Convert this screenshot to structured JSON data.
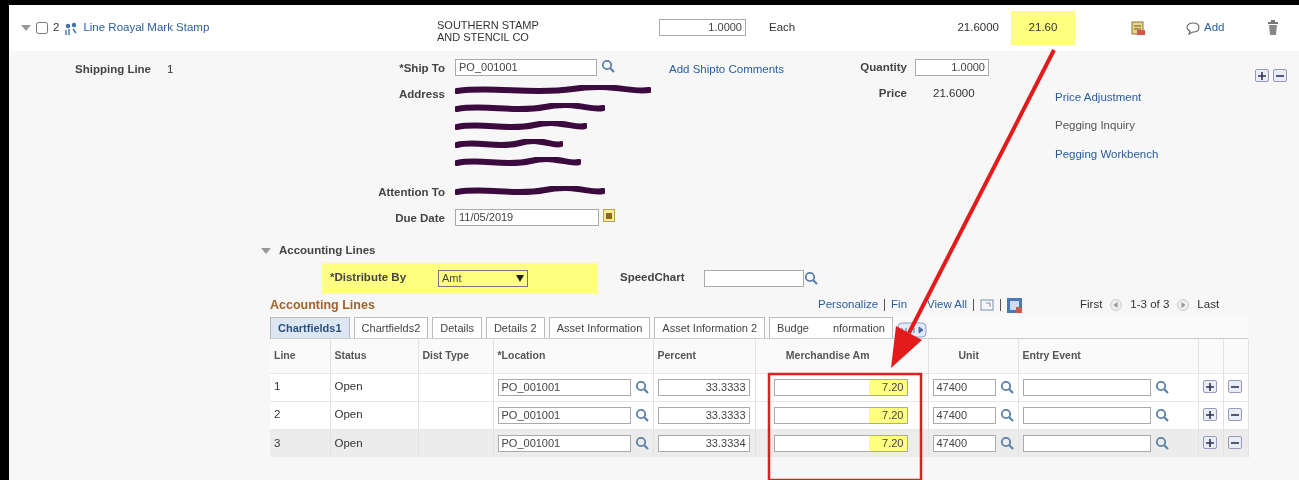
{
  "item_line": {
    "expanded": true,
    "checked": false,
    "number": "2",
    "description": "Line Roayal Mark Stamp",
    "vendor": [
      "SOUTHERN STAMP",
      "AND STENCIL CO"
    ],
    "quantity": "1.0000",
    "uom": "Each",
    "price": "21.6000",
    "amount": "21.60",
    "amount_highlighted": true,
    "comment_label": "Add"
  },
  "shipping": {
    "label": "Shipping Line",
    "number": "1",
    "ship_to_label": "*Ship To",
    "ship_to": "PO_001001",
    "address_label": "Address",
    "attention_label": "Attention To",
    "due_date_label": "Due Date",
    "due_date": "11/05/2019",
    "comments_link": "Add Shipto Comments",
    "quantity_label": "Quantity",
    "quantity": "1.0000",
    "price_label": "Price",
    "price": "21.6000",
    "links": [
      {
        "label": "Price Adjustment",
        "disabled": false
      },
      {
        "label": "Pegging Inquiry",
        "disabled": true
      },
      {
        "label": "Pegging Workbench",
        "disabled": false
      }
    ]
  },
  "accounting": {
    "section_title": "Accounting Lines",
    "expanded": true,
    "distribute_label": "*Distribute By",
    "distribute_value": "Amt",
    "distribute_highlighted": true,
    "speedchart_label": "SpeedChart",
    "grid_title": "Accounting Lines",
    "toolbar": [
      "Personalize",
      "Fin",
      "View All"
    ],
    "pager": {
      "first": "First",
      "range": "1-3 of 3",
      "last": "Last"
    },
    "tabs": [
      {
        "label": "Chartfields1",
        "selected": true
      },
      {
        "label": "Chartfields2",
        "selected": false
      },
      {
        "label": "Details",
        "selected": false
      },
      {
        "label": "Details 2",
        "selected": false
      },
      {
        "label": "Asset Information",
        "selected": false
      },
      {
        "label": "Asset Information 2",
        "selected": false
      },
      {
        "label": "Budge",
        "label_after": "nformation",
        "selected": false
      }
    ],
    "columns": [
      "Line",
      "Status",
      "Dist Type",
      "*Location",
      "Percent",
      "Merchandise Am",
      "Unit",
      "Entry Event"
    ],
    "rows": [
      {
        "line": "1",
        "status": "Open",
        "location": "PO_001001",
        "percent": "33.3333",
        "merchandise_amount": "7.20",
        "highlighted": true,
        "unit": "47400",
        "selected": false
      },
      {
        "line": "2",
        "status": "Open",
        "location": "PO_001001",
        "percent": "33.3333",
        "merchandise_amount": "7.20",
        "highlighted": true,
        "unit": "47400",
        "selected": false
      },
      {
        "line": "3",
        "status": "Open",
        "location": "PO_001001",
        "percent": "33.3334",
        "merchandise_amount": "7.20",
        "highlighted": true,
        "unit": "47400",
        "selected": true
      }
    ]
  }
}
